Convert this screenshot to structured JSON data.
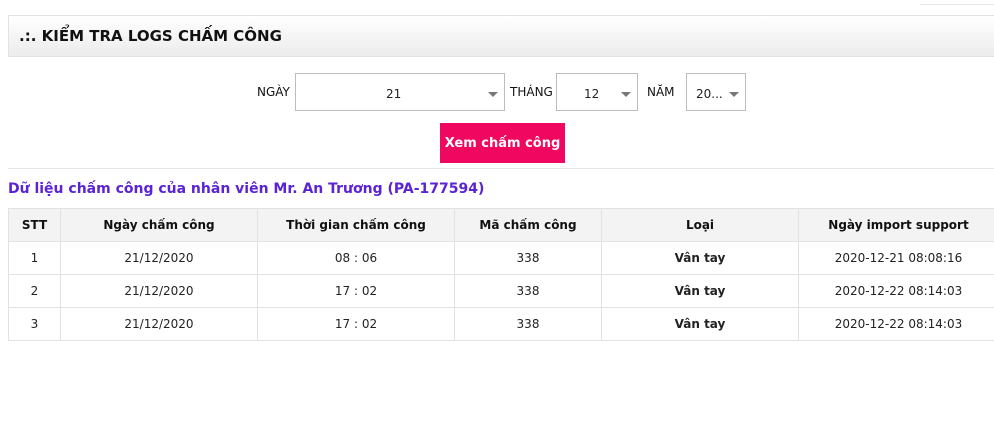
{
  "header": {
    "title": ".:. KIỂM TRA LOGS CHẤM CÔNG"
  },
  "filter": {
    "day_label": "NGÀY",
    "day_value": "21",
    "month_label": "THÁNG",
    "month_value": "12",
    "year_label": "NĂM",
    "year_value": "20...",
    "submit_label": "Xem chấm công"
  },
  "employee_title": "Dữ liệu chấm công của nhân viên Mr. An Trương (PA-177594)",
  "table": {
    "headers": [
      "STT",
      "Ngày chấm công",
      "Thời gian chấm công",
      "Mã chấm công",
      "Loại",
      "Ngày import support"
    ],
    "rows": [
      [
        "1",
        "21/12/2020",
        "08 : 06",
        "338",
        "Vân tay",
        "2020-12-21 08:08:16"
      ],
      [
        "2",
        "21/12/2020",
        "17 : 02",
        "338",
        "Vân tay",
        "2020-12-22 08:14:03"
      ],
      [
        "3",
        "21/12/2020",
        "17 : 02",
        "338",
        "Vân tay",
        "2020-12-22 08:14:03"
      ]
    ]
  },
  "colors": {
    "accent_button": "#f0075f",
    "employee_text": "#5b23d6"
  }
}
